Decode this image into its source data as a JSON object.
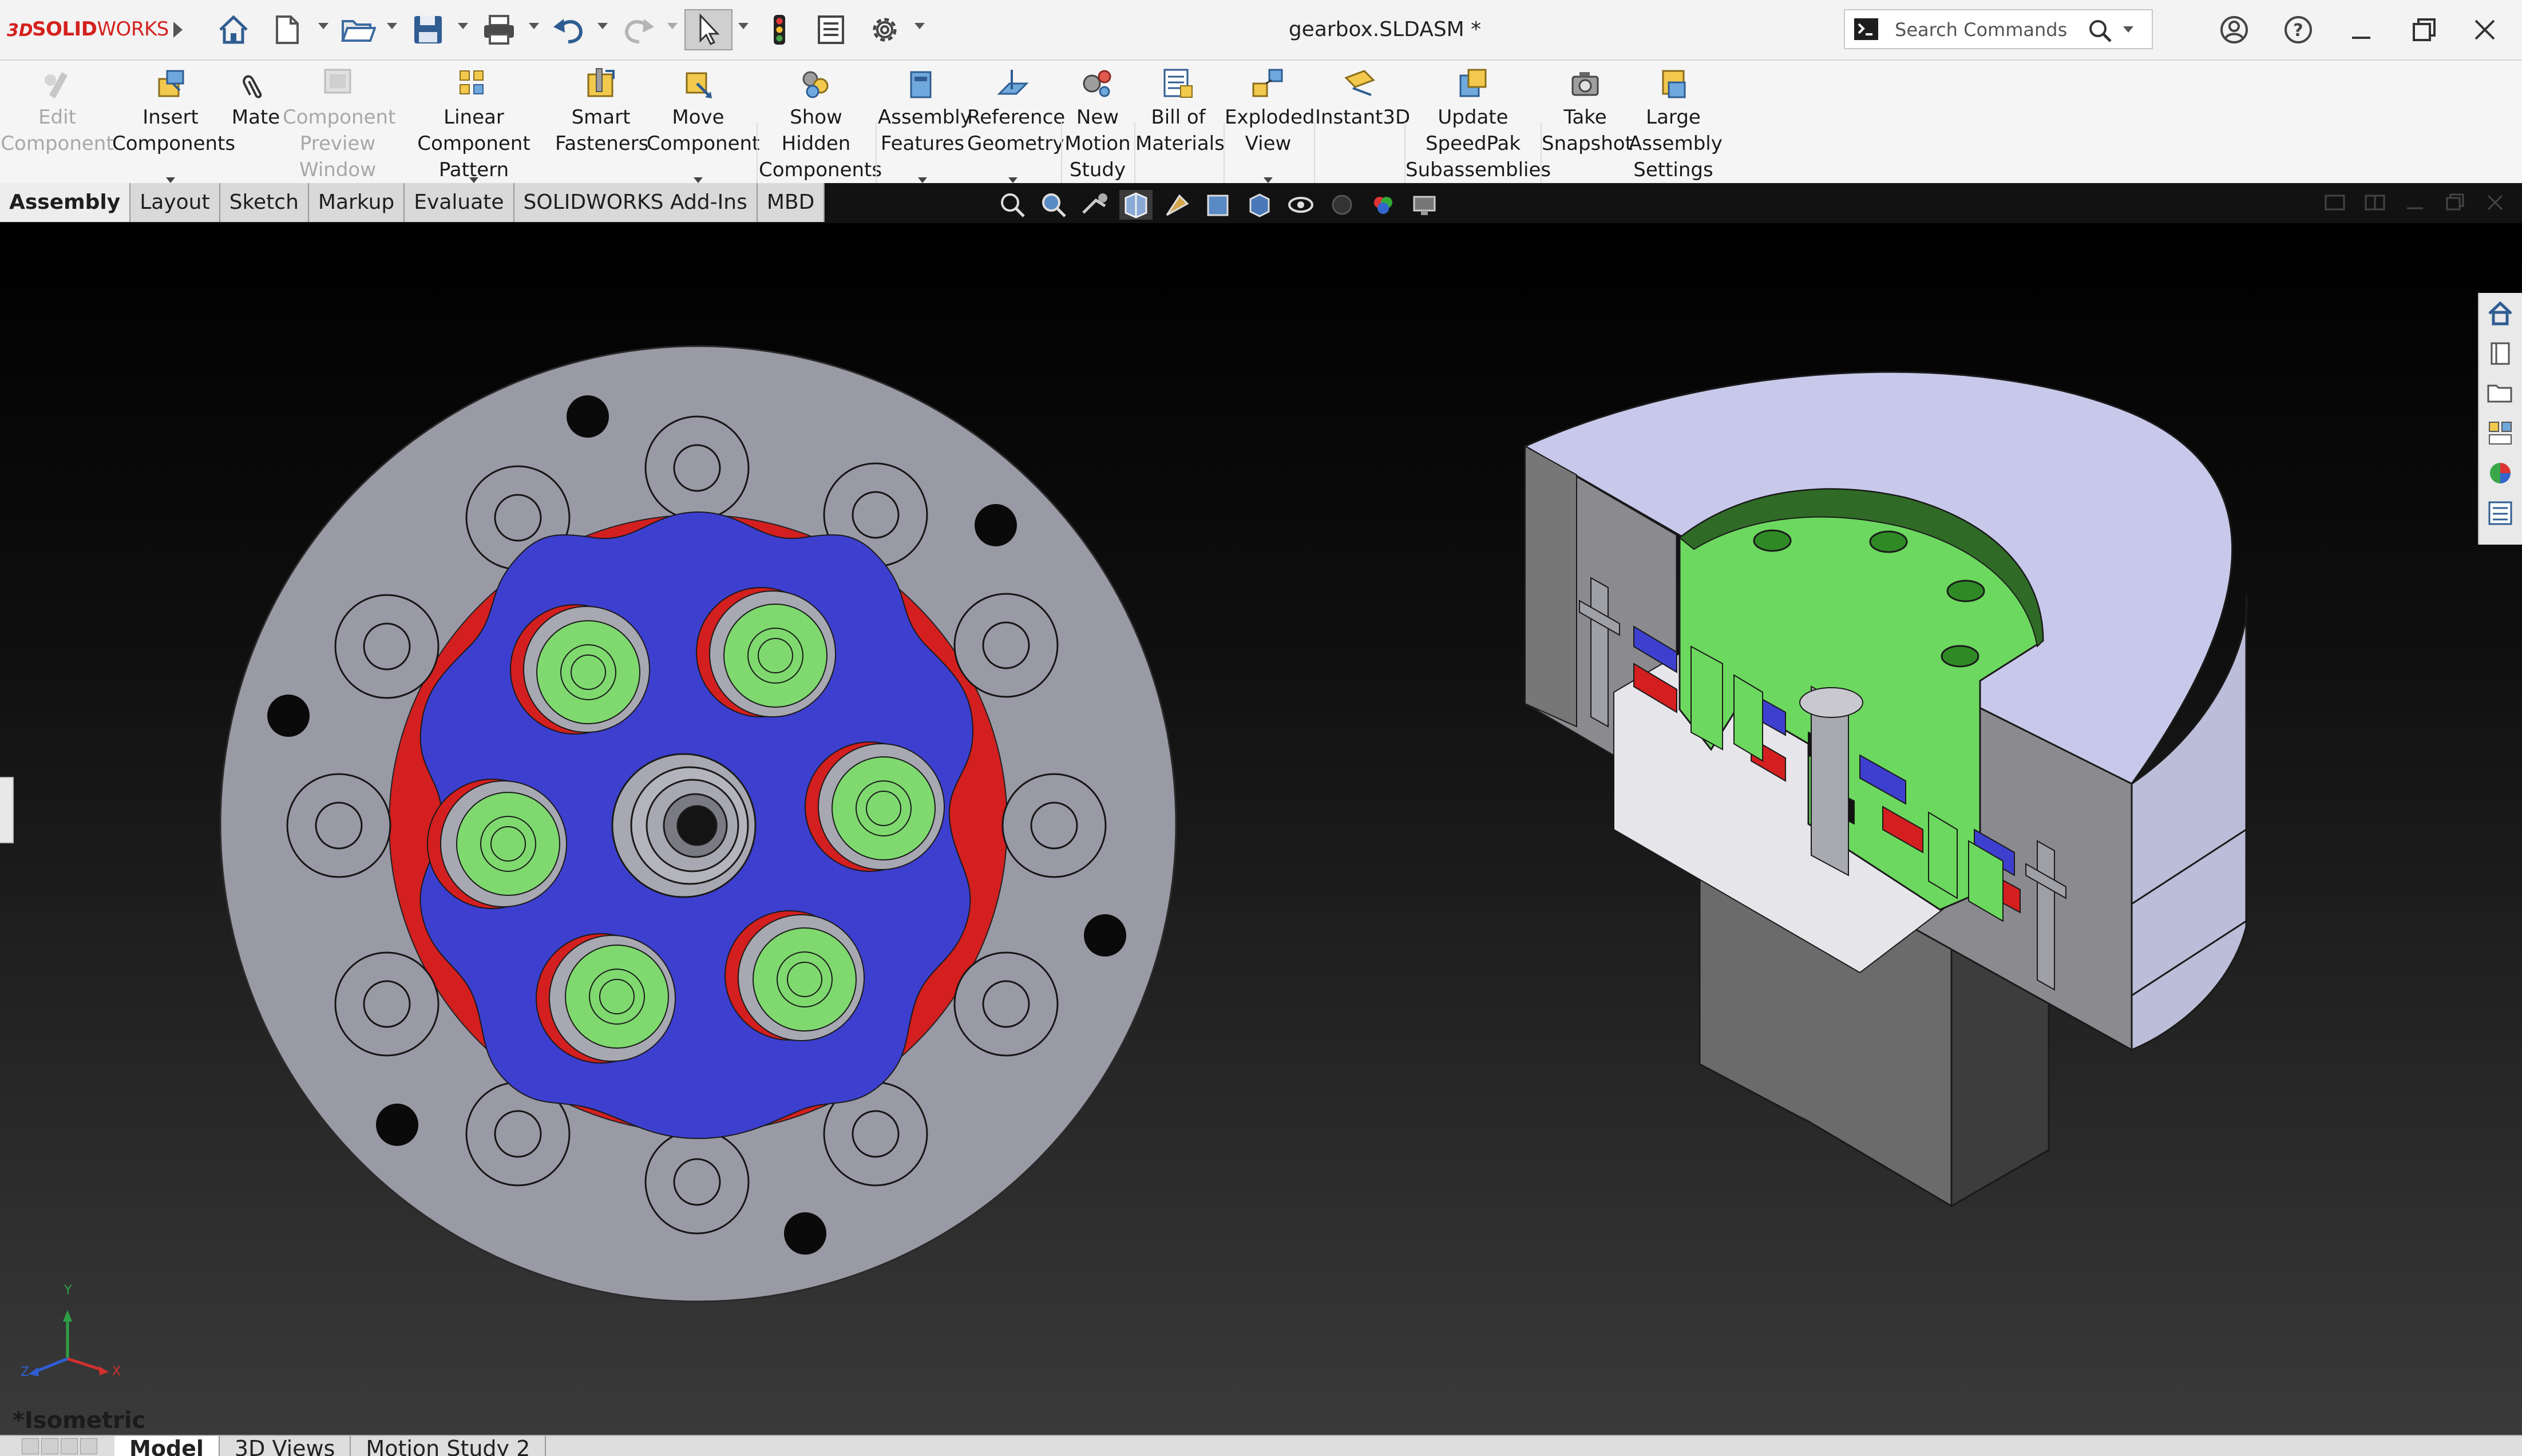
{
  "app": {
    "brand_prefix": "3DS",
    "brand_solid": "SOLID",
    "brand_works": "WORKS"
  },
  "document": {
    "title": "gearbox.SLDASM *"
  },
  "search": {
    "placeholder": "Search Commands"
  },
  "colors": {
    "accent_red": "#d4221e",
    "gear_blue": "#3d3fcf",
    "planet_green": "#7fd96f",
    "ring_red": "#d31f1f",
    "housing_gray": "#9a9aa6",
    "section_green": "#6dd85f",
    "housing_lavender": "#c8c9ea"
  },
  "ribbon": {
    "tools": [
      {
        "id": "edit-component",
        "label": "Edit\nComponent",
        "enabled": false,
        "dropdown": false,
        "icon": "edit-component-icon"
      },
      {
        "id": "insert-components",
        "label": "Insert\nComponents",
        "enabled": true,
        "dropdown": true,
        "icon": "insert-components-icon"
      },
      {
        "id": "mate",
        "label": "Mate",
        "enabled": true,
        "dropdown": false,
        "icon": "mate-paperclip-icon"
      },
      {
        "id": "component-preview-window",
        "label": "Component\nPreview\nWindow",
        "enabled": false,
        "dropdown": false,
        "icon": "component-preview-icon"
      },
      {
        "id": "linear-component-pattern",
        "label": "Linear Component\nPattern",
        "enabled": true,
        "dropdown": true,
        "icon": "linear-pattern-icon"
      },
      {
        "id": "smart-fasteners",
        "label": "Smart\nFasteners",
        "enabled": true,
        "dropdown": false,
        "icon": "smart-fasteners-icon"
      },
      {
        "id": "move-component",
        "label": "Move\nComponent",
        "enabled": true,
        "dropdown": true,
        "icon": "move-component-icon"
      },
      {
        "id": "show-hidden-components",
        "label": "Show\nHidden\nComponents",
        "enabled": true,
        "dropdown": false,
        "icon": "show-hidden-icon"
      },
      {
        "id": "assembly-features",
        "label": "Assembly\nFeatures",
        "enabled": true,
        "dropdown": true,
        "icon": "assembly-features-icon"
      },
      {
        "id": "reference-geometry",
        "label": "Reference\nGeometry",
        "enabled": true,
        "dropdown": true,
        "icon": "reference-geometry-icon"
      },
      {
        "id": "new-motion-study",
        "label": "New\nMotion\nStudy",
        "enabled": true,
        "dropdown": false,
        "icon": "motion-study-icon"
      },
      {
        "id": "bill-of-materials",
        "label": "Bill of\nMaterials",
        "enabled": true,
        "dropdown": false,
        "icon": "bill-of-materials-icon"
      },
      {
        "id": "exploded-view",
        "label": "Exploded\nView",
        "enabled": true,
        "dropdown": true,
        "icon": "exploded-view-icon"
      },
      {
        "id": "instant3d",
        "label": "Instant3D",
        "enabled": true,
        "dropdown": false,
        "icon": "instant3d-icon"
      },
      {
        "id": "update-speedpak",
        "label": "Update\nSpeedPak\nSubassemblies",
        "enabled": true,
        "dropdown": false,
        "icon": "speedpak-icon"
      },
      {
        "id": "take-snapshot",
        "label": "Take\nSnapshot",
        "enabled": true,
        "dropdown": false,
        "icon": "camera-icon"
      },
      {
        "id": "large-assembly-settings",
        "label": "Large\nAssembly\nSettings",
        "enabled": true,
        "dropdown": false,
        "icon": "large-assembly-icon"
      }
    ]
  },
  "tabs": [
    {
      "label": "Assembly",
      "active": true
    },
    {
      "label": "Layout",
      "active": false
    },
    {
      "label": "Sketch",
      "active": false
    },
    {
      "label": "Markup",
      "active": false
    },
    {
      "label": "Evaluate",
      "active": false
    },
    {
      "label": "SOLIDWORKS Add-Ins",
      "active": false
    },
    {
      "label": "MBD",
      "active": false
    }
  ],
  "viewport": {
    "orientation_label": "*Isometric",
    "triad": {
      "x": "X",
      "y": "Y",
      "z": "Z"
    }
  },
  "bottom_tabs": [
    {
      "label": "Model",
      "active": true
    },
    {
      "label": "3D Views",
      "active": false
    },
    {
      "label": "Motion Study 2",
      "active": false
    }
  ]
}
